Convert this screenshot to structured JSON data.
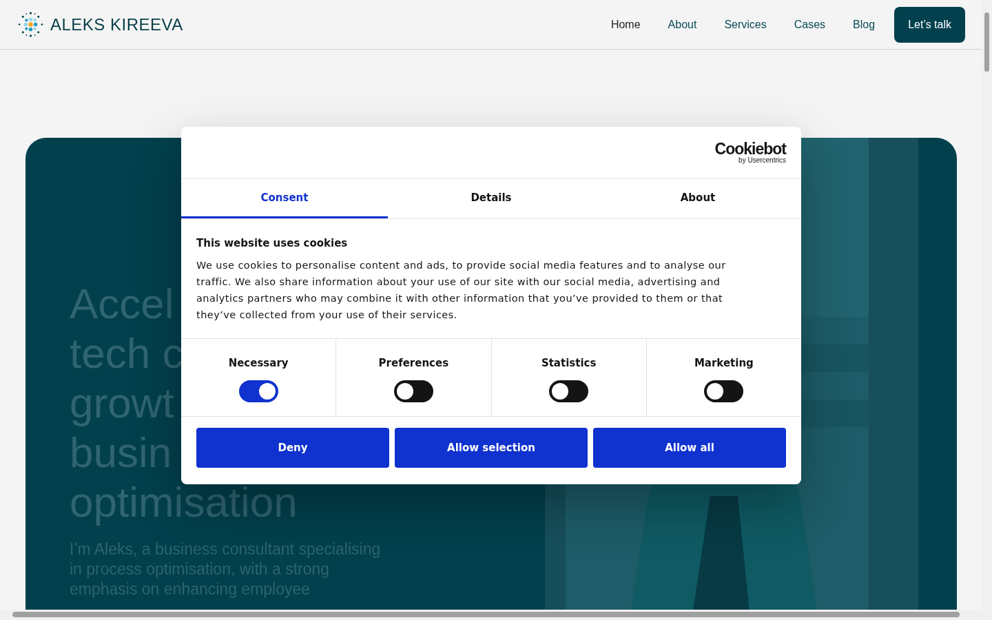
{
  "header": {
    "brand": "ALEKS KIREEVA",
    "nav": [
      {
        "label": "Home",
        "selected": true
      },
      {
        "label": "About",
        "selected": false
      },
      {
        "label": "Services",
        "selected": false
      },
      {
        "label": "Cases",
        "selected": false
      },
      {
        "label": "Blog",
        "selected": false
      }
    ],
    "cta": "Let’s talk"
  },
  "hero": {
    "heading_lines": [
      "Accel",
      "tech c",
      "growt",
      "busin",
      "optimisation"
    ],
    "intro_lines": [
      "I’m Aleks, a business consultant specialising",
      "in process optimisation, with a strong",
      "emphasis on enhancing employee"
    ],
    "photo": {
      "kind": "picture"
    }
  },
  "cookie_dialog": {
    "brand": "Cookiebot",
    "brand_sub": "by Usercentrics",
    "tabs": [
      {
        "label": "Consent",
        "selected": true
      },
      {
        "label": "Details",
        "selected": false
      },
      {
        "label": "About",
        "selected": false
      }
    ],
    "title": "This website uses cookies",
    "body": "We use cookies to personalise content and ads, to provide social media features and to analyse our traffic. We also share information about your use of our site with our social media, advertising and analytics partners who may combine it with other information that you’ve provided to them or that they’ve collected from your use of their services.",
    "categories": [
      {
        "label": "Necessary",
        "on": true
      },
      {
        "label": "Preferences",
        "on": false
      },
      {
        "label": "Statistics",
        "on": false
      },
      {
        "label": "Marketing",
        "on": false
      }
    ],
    "buttons": [
      "Deny",
      "Allow selection",
      "Allow all"
    ]
  }
}
